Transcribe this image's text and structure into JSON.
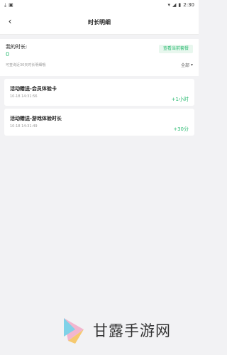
{
  "status_bar": {
    "left_icons": [
      "download-icon",
      "app-icon"
    ],
    "time": "2:30",
    "right_icons": [
      "wifi-icon",
      "signal-icon",
      "battery-icon"
    ]
  },
  "header": {
    "back_icon": "back-arrow-icon",
    "title": "时长明细"
  },
  "summary": {
    "label": "我的时长:",
    "value": "0",
    "plan_button": "查看当前套餐",
    "hint": "可查询近30天时长明细哦",
    "filter_label": "全部",
    "filter_icon": "caret-down-icon"
  },
  "records": [
    {
      "title": "活动赠送-会员体验卡",
      "time": "10-18 14:31:56",
      "amount": "+1小时"
    },
    {
      "title": "活动赠送-游戏体验时长",
      "time": "10-18 14:31:49",
      "amount": "+30分"
    }
  ],
  "watermark": {
    "text": "甘露手游网"
  },
  "colors": {
    "accent": "#2bbb72",
    "background": "#f2f2f4"
  }
}
